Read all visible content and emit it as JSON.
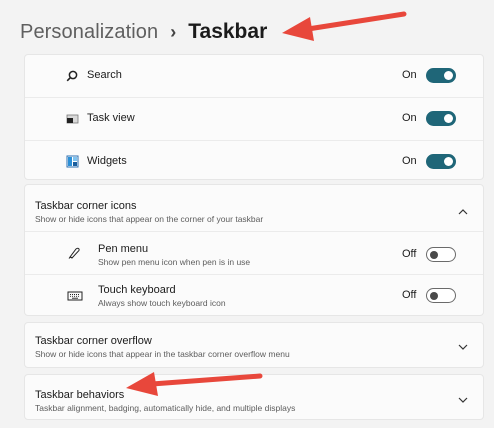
{
  "breadcrumb": {
    "parent": "Personalization",
    "separator": "›",
    "current": "Taskbar"
  },
  "taskbar_items": [
    {
      "label": "Search",
      "state": "On",
      "on": true,
      "icon": "search-icon"
    },
    {
      "label": "Task view",
      "state": "On",
      "on": true,
      "icon": "task-view-icon"
    },
    {
      "label": "Widgets",
      "state": "On",
      "on": true,
      "icon": "widgets-icon"
    }
  ],
  "corner_icons": {
    "title": "Taskbar corner icons",
    "subtitle": "Show or hide icons that appear on the corner of your taskbar",
    "expanded": true,
    "items": [
      {
        "label": "Pen menu",
        "subtitle": "Show pen menu icon when pen is in use",
        "state": "Off",
        "on": false,
        "icon": "pen-icon"
      },
      {
        "label": "Touch keyboard",
        "subtitle": "Always show touch keyboard icon",
        "state": "Off",
        "on": false,
        "icon": "keyboard-icon"
      }
    ]
  },
  "corner_overflow": {
    "title": "Taskbar corner overflow",
    "subtitle": "Show or hide icons that appear in the taskbar corner overflow menu",
    "expanded": false
  },
  "behaviors": {
    "title": "Taskbar behaviors",
    "subtitle": "Taskbar alignment, badging, automatically hide, and multiple displays",
    "expanded": false
  },
  "colors": {
    "accent": "#1f6678",
    "arrow": "#e8473b"
  }
}
